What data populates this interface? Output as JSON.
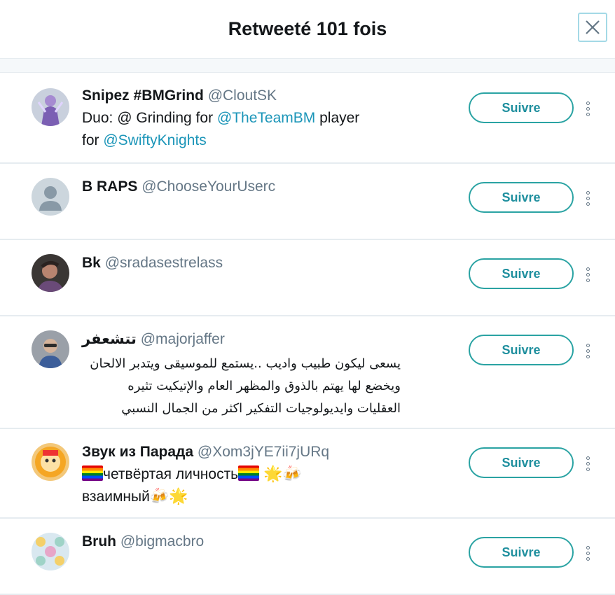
{
  "dialog": {
    "title": "Retweeté 101 fois",
    "close_label": "×"
  },
  "users": [
    {
      "name": "Snipez #BMGrind",
      "handle": "@CloutSK",
      "bio_segments": [
        "Duo: @ Grinding for ",
        "@TheTeamBM",
        " player",
        "for ",
        "@SwiftyKnights"
      ],
      "follow_label": "Suivre"
    },
    {
      "name": "B RAPS",
      "handle": "@ChooseYourUserc",
      "follow_label": "Suivre"
    },
    {
      "name": "Bk",
      "handle": "@sradasestrelass",
      "follow_label": "Suivre"
    },
    {
      "name": "تتشعفر",
      "handle": "@majorjaffer",
      "bio": "يسعى ليكون طبيب واديب ..يستمع للموسيقى ويتدبر الالحان ويخضع لها يهتم بالذوق والمظهر العام والإتيكيت تثيره العقليات وايديولوجيات التفكير اكثر من الجمال النسبي",
      "follow_label": "Suivre"
    },
    {
      "name": "Звук из Парада",
      "handle": "@Xom3jYE7ii7jURq",
      "bio_line1": "четвёртая личность",
      "bio_line2": "взаимный",
      "emoji_star": "🌟",
      "emoji_beer": "🍻",
      "follow_label": "Suivre"
    },
    {
      "name": "Bruh",
      "handle": "@bigmacbro",
      "follow_label": "Suivre"
    }
  ]
}
